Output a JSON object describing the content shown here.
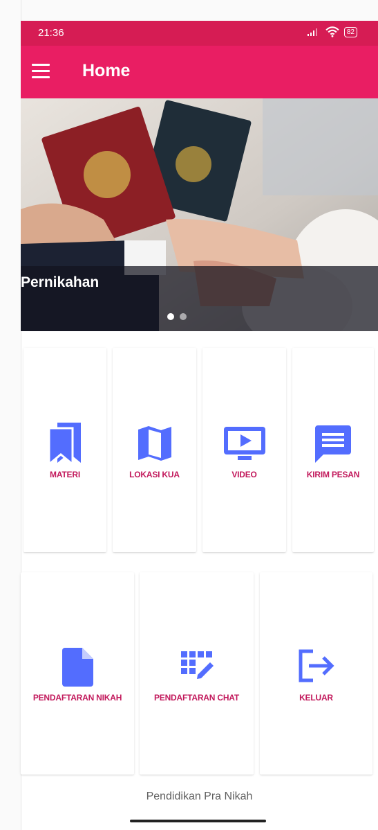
{
  "status_bar": {
    "time": "21:36",
    "battery": "82"
  },
  "app_bar": {
    "title": "Home",
    "menu_icon": "hamburger-menu-icon"
  },
  "banner": {
    "caption": "Pernikahan",
    "slide_count": 2,
    "active_slide": 1
  },
  "menu": {
    "row1": [
      {
        "label": "MATERI",
        "icon": "bookmarks-icon"
      },
      {
        "label": "LOKASI KUA",
        "icon": "map-icon"
      },
      {
        "label": "VIDEO",
        "icon": "video-icon"
      },
      {
        "label": "KIRIM PESAN",
        "icon": "message-icon"
      }
    ],
    "row2": [
      {
        "label": "PENDAFTARAN NIKAH",
        "icon": "document-icon"
      },
      {
        "label": "PENDAFTARAN CHAT",
        "icon": "edit-grid-icon"
      },
      {
        "label": "KELUAR",
        "icon": "logout-icon"
      }
    ]
  },
  "footer": {
    "text": "Pendidikan Pra Nikah"
  },
  "colors": {
    "primary": "#e91e63",
    "status": "#d61c54",
    "icon": "#536dfe",
    "label": "#c2185b"
  }
}
